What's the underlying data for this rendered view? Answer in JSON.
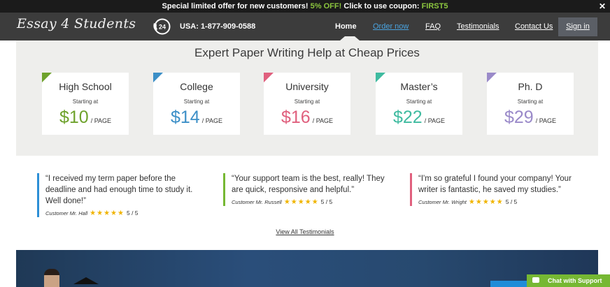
{
  "promo": {
    "text": "Special limited offer for new customers! ",
    "discount": "5% OFF!",
    "text2": " Click to use coupon: ",
    "coupon": "FIRST5",
    "close": "✕"
  },
  "header": {
    "logo": "Essay 4 Students",
    "phone_badge": "24",
    "phone": "USA: 1-877-909-0588",
    "nav": {
      "home": "Home",
      "order": "Order now",
      "faq": "FAQ",
      "testimonials": "Testimonials",
      "contact": "Contact Us"
    },
    "signin": "Sign in"
  },
  "pricing": {
    "title": "Expert Paper Writing Help at Cheap Prices",
    "starting_label": "Starting at",
    "unit": "/ PAGE",
    "levels": [
      {
        "name": "High School",
        "price": "$10",
        "color": "#6ea22c"
      },
      {
        "name": "College",
        "price": "$14",
        "color": "#3c8fc7"
      },
      {
        "name": "University",
        "price": "$16",
        "color": "#e0607e"
      },
      {
        "name": "Master’s",
        "price": "$22",
        "color": "#3fbba0"
      },
      {
        "name": "Ph. D",
        "price": "$29",
        "color": "#9a8ac9"
      }
    ]
  },
  "testimonials": [
    {
      "quote": "“I received my term paper before the deadline and had enough time to study it. Well done!”",
      "author": "Customer Mr. Hall",
      "stars": "★★★★★",
      "score": "5 / 5",
      "color": "#2d8fd6"
    },
    {
      "quote": "“Your support team is the best, really! They are quick, responsive and helpful.”",
      "author": "Customer Mr. Russell",
      "stars": "★★★★★",
      "score": "5 / 5",
      "color": "#76b833"
    },
    {
      "quote": "“I'm so grateful I found your company! Your writer is fantastic, he saved my studies.”",
      "author": "Customer Mr. Wright",
      "stars": "★★★★★",
      "score": "5 / 5",
      "color": "#e0607e"
    }
  ],
  "view_all": "View All Testimonials",
  "chat": "Chat with Support"
}
